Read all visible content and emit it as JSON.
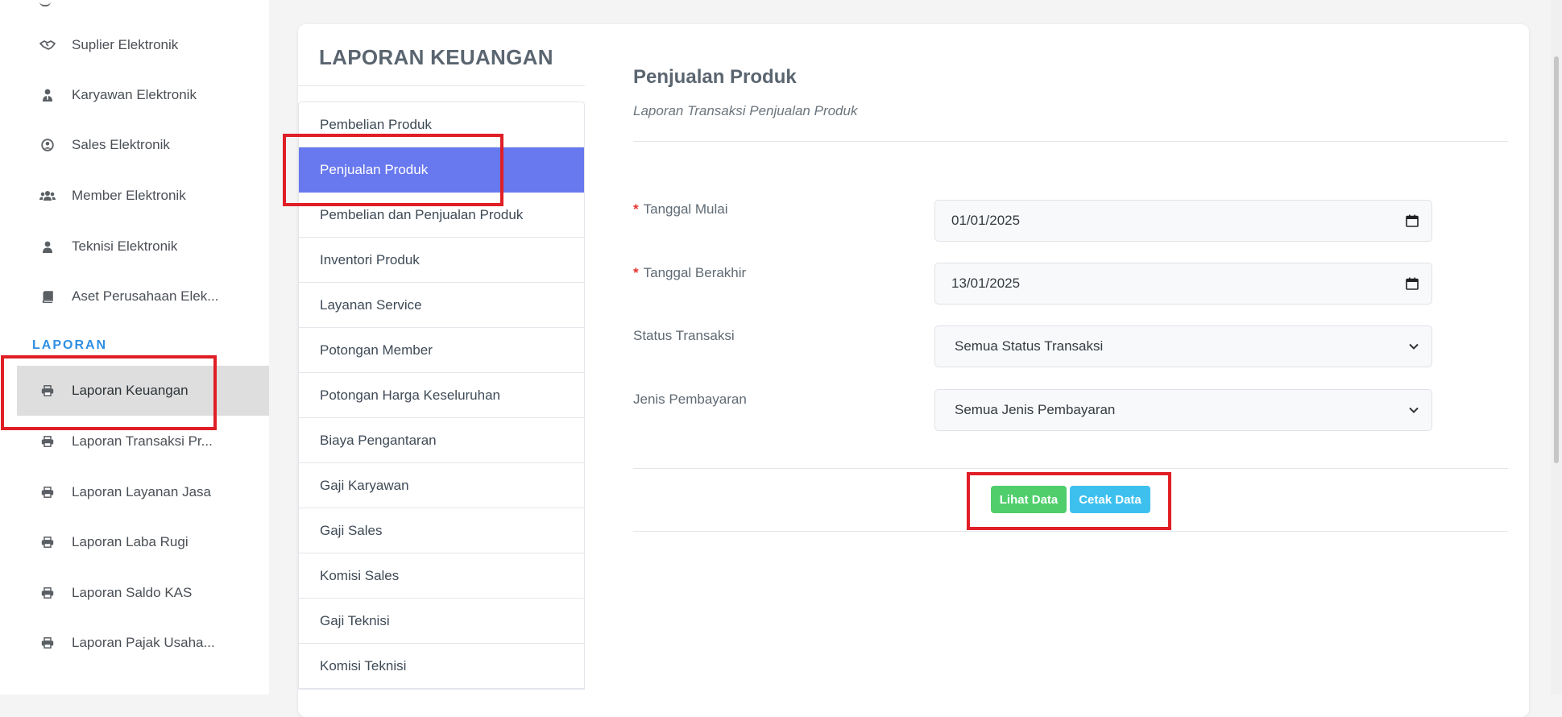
{
  "sidebar": {
    "items": [
      {
        "label": "Suplier Elektronik",
        "icon": "handshake-icon"
      },
      {
        "label": "Karyawan Elektronik",
        "icon": "user-tie-icon"
      },
      {
        "label": "Sales Elektronik",
        "icon": "user-circle-icon"
      },
      {
        "label": "Member Elektronik",
        "icon": "users-icon"
      },
      {
        "label": "Teknisi Elektronik",
        "icon": "user-icon"
      },
      {
        "label": "Aset Perusahaan Elek...",
        "icon": "book-icon"
      }
    ],
    "section_heading": "LAPORAN",
    "report_items": [
      {
        "label": "Laporan Keuangan",
        "icon": "printer-icon",
        "active": true
      },
      {
        "label": "Laporan Transaksi Pr...",
        "icon": "printer-icon"
      },
      {
        "label": "Laporan Layanan Jasa",
        "icon": "printer-icon"
      },
      {
        "label": "Laporan Laba Rugi",
        "icon": "printer-icon"
      },
      {
        "label": "Laporan Saldo KAS",
        "icon": "printer-icon"
      },
      {
        "label": "Laporan Pajak Usaha...",
        "icon": "printer-icon"
      }
    ]
  },
  "card": {
    "title": "LAPORAN KEUANGAN",
    "menu": [
      "Pembelian Produk",
      "Penjualan Produk",
      "Pembelian dan Penjualan Produk",
      "Inventori Produk",
      "Layanan Service",
      "Potongan Member",
      "Potongan Harga Keseluruhan",
      "Biaya Pengantaran",
      "Gaji Karyawan",
      "Gaji Sales",
      "Komisi Sales",
      "Gaji Teknisi",
      "Komisi Teknisi"
    ],
    "active_menu": "Penjualan Produk"
  },
  "form": {
    "title": "Penjualan Produk",
    "subtitle": "Laporan Transaksi Penjualan Produk",
    "required_mark": "*",
    "start_date_label": "Tanggal Mulai",
    "start_date_value": "01/01/2025",
    "end_date_label": "Tanggal Berakhir",
    "end_date_value": "13/01/2025",
    "status_label": "Status Transaksi",
    "status_value": "Semua Status Transaksi",
    "payment_label": "Jenis Pembayaran",
    "payment_value": "Semua Jenis Pembayaran",
    "view_button": "Lihat Data",
    "print_button": "Cetak Data"
  },
  "colors": {
    "active_menu_bg": "#6878ee",
    "section_heading": "#2f8fe3",
    "highlight": "#e01e25",
    "view_button": "#4fce6b",
    "print_button": "#3ec0ef"
  }
}
